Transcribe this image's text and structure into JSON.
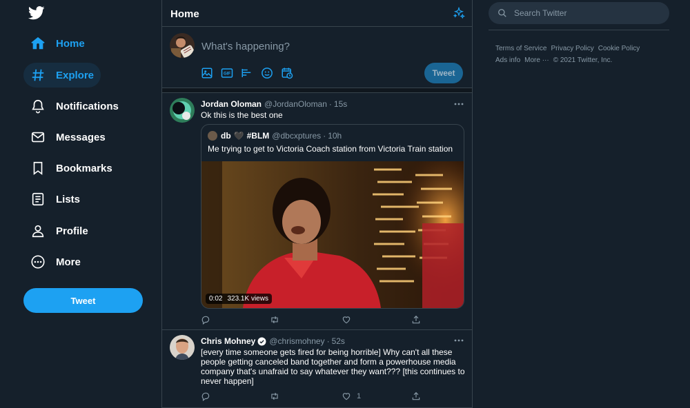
{
  "colors": {
    "background": "#15202b",
    "accent": "#1da1f2",
    "border": "#38444d",
    "muted": "#8899a6"
  },
  "nav": {
    "items": [
      {
        "label": "Home",
        "icon": "home-icon"
      },
      {
        "label": "Explore",
        "icon": "hashtag-icon"
      },
      {
        "label": "Notifications",
        "icon": "bell-icon"
      },
      {
        "label": "Messages",
        "icon": "envelope-icon"
      },
      {
        "label": "Bookmarks",
        "icon": "bookmark-icon"
      },
      {
        "label": "Lists",
        "icon": "list-icon"
      },
      {
        "label": "Profile",
        "icon": "person-icon"
      },
      {
        "label": "More",
        "icon": "more-circle-icon"
      }
    ],
    "active": "Home",
    "tweet_button": "Tweet"
  },
  "timeline": {
    "title": "Home",
    "compose": {
      "placeholder": "What's happening?",
      "tools": [
        "image-icon",
        "gif-icon",
        "poll-icon",
        "emoji-icon",
        "schedule-icon"
      ],
      "tweet_button": "Tweet"
    },
    "tweets": [
      {
        "name": "Jordan Oloman",
        "handle": "@JordanOloman",
        "time": "15s",
        "text": "Ok this is the best one",
        "quote": {
          "name": "db",
          "heart": "🖤",
          "tag": "#BLM",
          "handle": "@dbcxptures",
          "time": "10h",
          "text": "Me trying to get to Victoria Coach station from Victoria Train station",
          "duration": "0:02",
          "views": "323.1K views"
        },
        "likes": ""
      },
      {
        "name": "Chris Mohney",
        "handle": "@chrismohney",
        "time": "52s",
        "verified": true,
        "text": "[every time someone gets fired for being horrible] Why can't all these people getting canceled band together and form a powerhouse media company that's unafraid to say whatever they want??? [this continues to never happen]",
        "likes": "1"
      }
    ]
  },
  "sidebar": {
    "search_placeholder": "Search Twitter",
    "footer": [
      "Terms of Service",
      "Privacy Policy",
      "Cookie Policy",
      "Ads info",
      "More ···",
      "© 2021 Twitter, Inc."
    ]
  }
}
